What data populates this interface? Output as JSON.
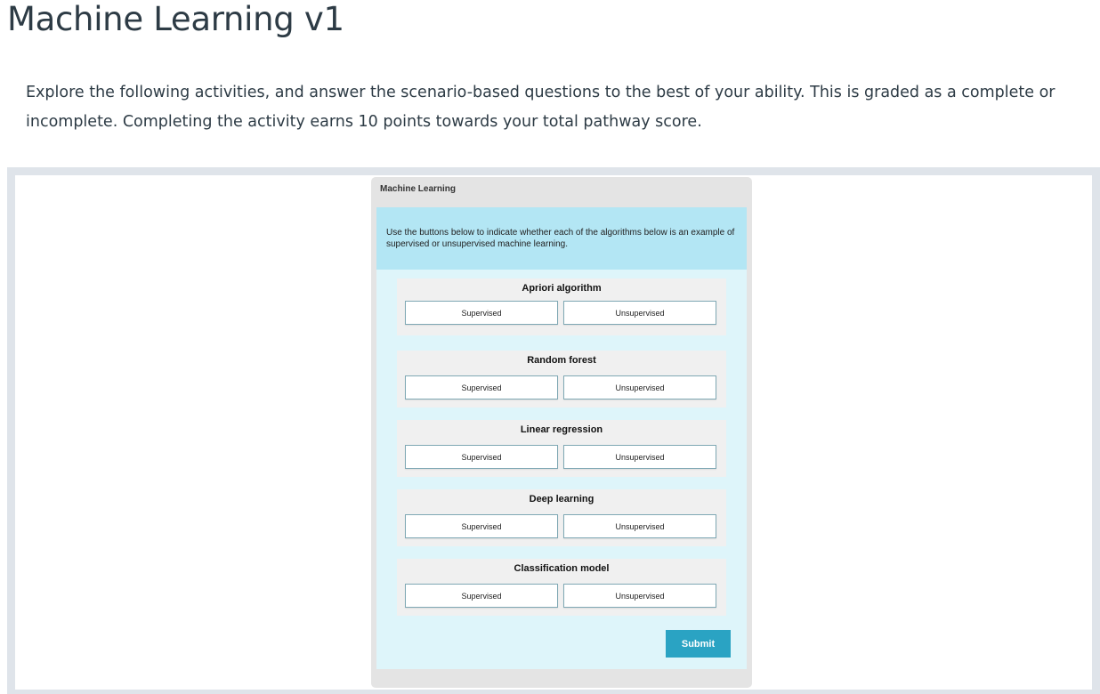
{
  "page": {
    "title": "Machine Learning v1",
    "intro": "Explore the following activities, and answer the scenario-based questions to the best of your ability. This is graded as a complete or incomplete. Completing the activity earns 10 points towards your total pathway score."
  },
  "widget": {
    "title": "Machine Learning",
    "instructions": "Use the buttons below to indicate whether each of the algorithms below is an example of supervised or unsupervised machine learning.",
    "questions": [
      {
        "label": "Apriori algorithm",
        "option_a": "Supervised",
        "option_b": "Unsupervised"
      },
      {
        "label": "Random forest",
        "option_a": "Supervised",
        "option_b": "Unsupervised"
      },
      {
        "label": "Linear regression",
        "option_a": "Supervised",
        "option_b": "Unsupervised"
      },
      {
        "label": "Deep learning",
        "option_a": "Supervised",
        "option_b": "Unsupervised"
      },
      {
        "label": "Classification model",
        "option_a": "Supervised",
        "option_b": "Unsupervised"
      }
    ],
    "submit_label": "Submit"
  },
  "colors": {
    "frame": "#dfe4ea",
    "widget_bg": "#e4e4e4",
    "instructions_bg": "#b3e6f4",
    "body_bg": "#def5fa",
    "submit_bg": "#2aa3c3"
  }
}
